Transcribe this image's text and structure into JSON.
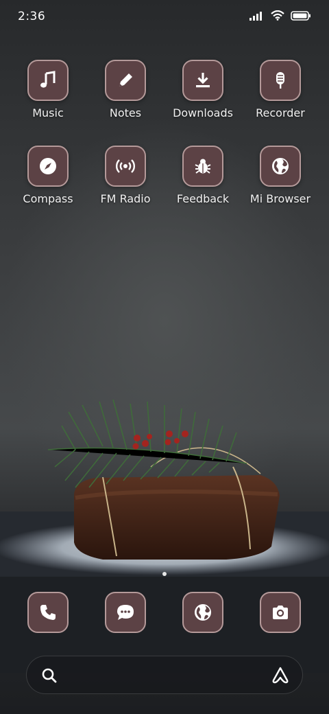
{
  "status_bar": {
    "time": "2:36",
    "icons": [
      "signal-icon",
      "wifi-icon",
      "battery-icon"
    ]
  },
  "apps_row1": [
    {
      "label": "Music",
      "icon": "music-note-icon"
    },
    {
      "label": "Notes",
      "icon": "pencil-icon"
    },
    {
      "label": "Downloads",
      "icon": "download-icon"
    },
    {
      "label": "Recorder",
      "icon": "microphone-icon"
    }
  ],
  "apps_row2": [
    {
      "label": "Compass",
      "icon": "compass-icon"
    },
    {
      "label": "FM Radio",
      "icon": "radio-broadcast-icon"
    },
    {
      "label": "Feedback",
      "icon": "bug-icon"
    },
    {
      "label": "Mi Browser",
      "icon": "globe-icon"
    }
  ],
  "dock": [
    {
      "icon": "phone-icon"
    },
    {
      "icon": "message-icon"
    },
    {
      "icon": "globe-icon"
    },
    {
      "icon": "camera-icon"
    }
  ],
  "search": {
    "icons": [
      "search-icon",
      "assistant-icon"
    ]
  },
  "colors": {
    "tile_bg": "#5c4245",
    "tile_border": "#b59a9a"
  }
}
